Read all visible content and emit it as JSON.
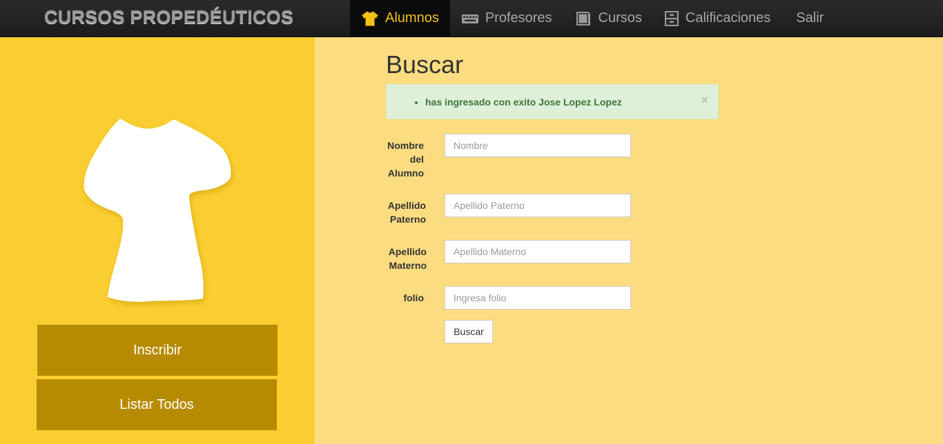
{
  "navbar": {
    "brand": "CURSOS PROPEDÉUTICOS",
    "items": [
      {
        "label": "Alumnos",
        "icon": "tshirt-icon",
        "active": true
      },
      {
        "label": "Profesores",
        "icon": "keyboard-icon",
        "active": false
      },
      {
        "label": "Cursos",
        "icon": "book-icon",
        "active": false
      },
      {
        "label": "Calificaciones",
        "icon": "archive-icon",
        "active": false
      },
      {
        "label": "Salir",
        "icon": "",
        "active": false
      }
    ]
  },
  "sidebar": {
    "image_icon": "tshirt-icon",
    "buttons": {
      "inscribir": "Inscribir",
      "listar": "Listar Todos"
    }
  },
  "main": {
    "title": "Buscar",
    "alert": {
      "message": "has ingresado con exito Jose Lopez Lopez",
      "close": "×"
    },
    "form": {
      "nombre": {
        "label": "Nombre del Alumno",
        "placeholder": "Nombre",
        "value": ""
      },
      "paterno": {
        "label": "Apellido Paterno",
        "placeholder": "Apellido Paterno",
        "value": ""
      },
      "materno": {
        "label": "Apellido Materno",
        "placeholder": "Apellido Materno",
        "value": ""
      },
      "folio": {
        "label": "folio",
        "placeholder": "Ingresa folio",
        "value": ""
      },
      "submit": "Buscar"
    }
  },
  "colors": {
    "navbar": "#1f1f1f",
    "nav_active_text": "#f6c21a",
    "sidebar": "#face30",
    "main": "#fbdc80",
    "side_button": "#b78b00",
    "alert_bg": "#dff0d8",
    "alert_text": "#3c763d"
  }
}
